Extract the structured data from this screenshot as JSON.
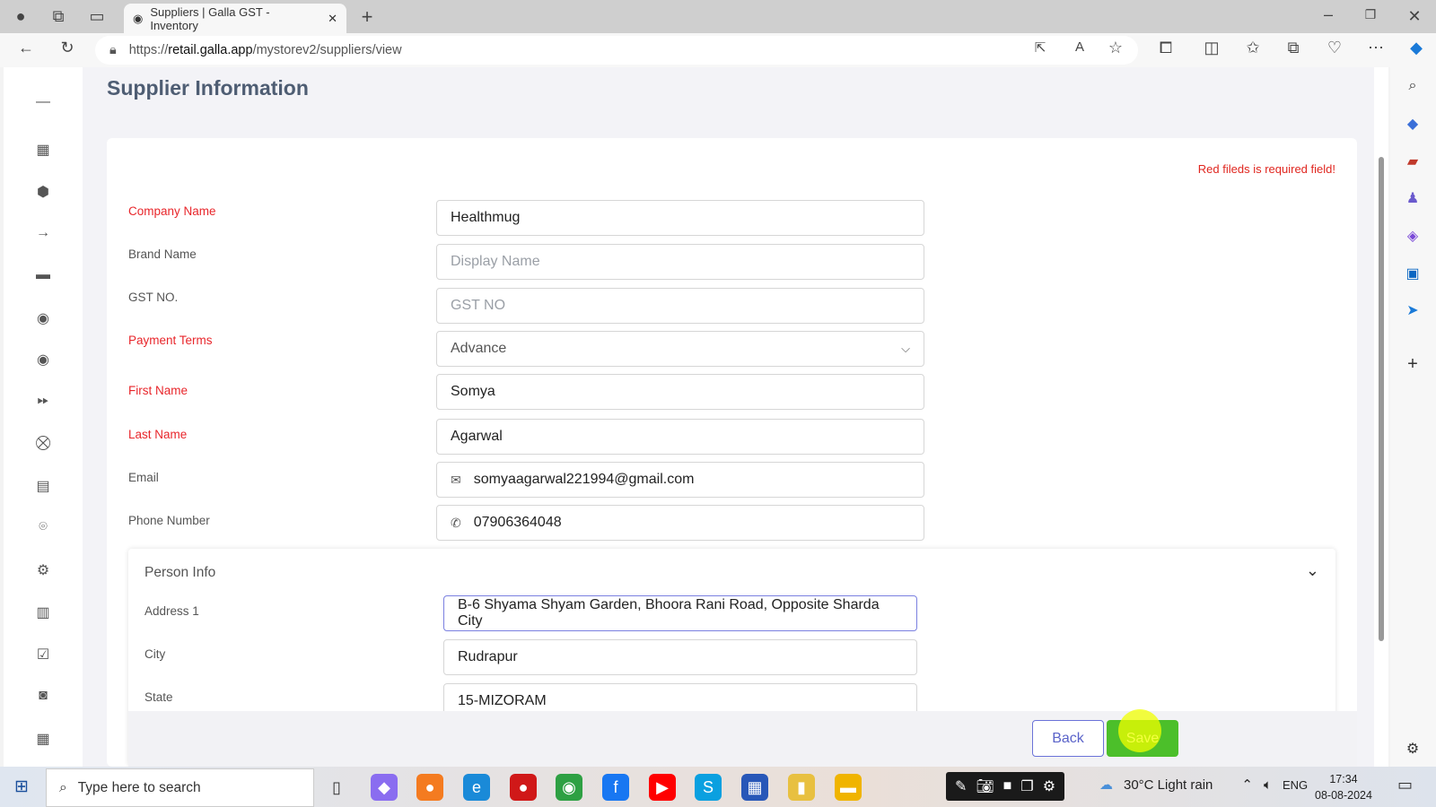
{
  "browser": {
    "tab_title": "Suppliers | Galla GST - Inventory",
    "url_prefix": "https://",
    "url_domain": "retail.galla.app",
    "url_path": "/mystorev2/suppliers/view"
  },
  "page": {
    "title": "Supplier Information",
    "required_note": "Red fileds is required field!"
  },
  "form": {
    "company_name": {
      "label": "Company Name",
      "value": "Healthmug",
      "required": true
    },
    "brand_name": {
      "label": "Brand Name",
      "placeholder": "Display Name"
    },
    "gst_no": {
      "label": "GST NO.",
      "placeholder": "GST NO"
    },
    "payment_terms": {
      "label": "Payment Terms",
      "value": "Advance",
      "required": true
    },
    "first_name": {
      "label": "First Name",
      "value": "Somya",
      "required": true
    },
    "last_name": {
      "label": "Last Name",
      "value": "Agarwal",
      "required": true
    },
    "email": {
      "label": "Email",
      "value": "somyaagarwal221994@gmail.com"
    },
    "phone": {
      "label": "Phone Number",
      "value": "07906364048"
    }
  },
  "person_info": {
    "title": "Person Info",
    "address1": {
      "label": "Address 1",
      "value": "B-6 Shyama Shyam Garden, Bhoora Rani Road, Opposite Sharda City"
    },
    "city": {
      "label": "City",
      "value": "Rudrapur"
    },
    "state": {
      "label": "State",
      "value": "15-MIZORAM"
    }
  },
  "actions": {
    "back": "Back",
    "save": "Save"
  },
  "colors": {
    "required": "#e8262b",
    "save": "#4cbf2a",
    "back": "#5a63c9"
  },
  "taskbar": {
    "search_placeholder": "Type here to search",
    "weather": "30°C  Light rain",
    "lang": "ENG",
    "time": "17:34",
    "date": "08-08-2024"
  }
}
